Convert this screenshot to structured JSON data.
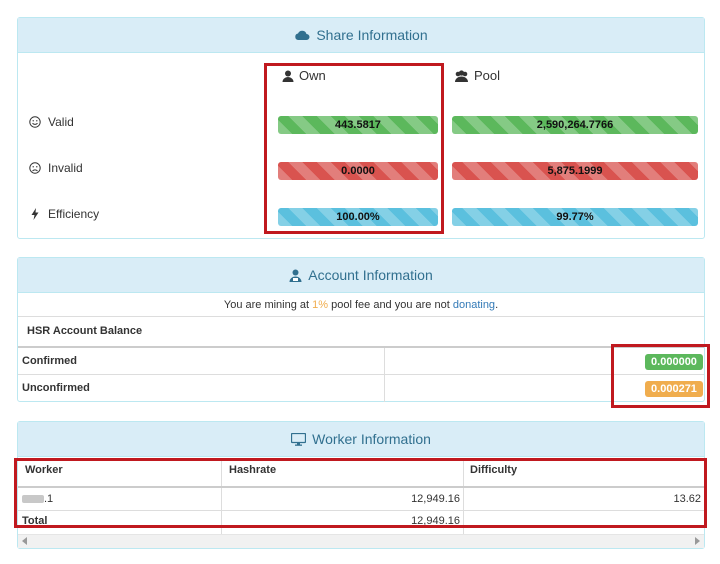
{
  "share_panel": {
    "title": "Share Information",
    "col_own": "Own",
    "col_pool": "Pool",
    "rows": [
      {
        "label": "Valid",
        "own": "443.5817",
        "pool": "2,590,264.7766"
      },
      {
        "label": "Invalid",
        "own": "0.0000",
        "pool": "5,875.1999"
      },
      {
        "label": "Efficiency",
        "own": "100.00%",
        "pool": "99.77%"
      }
    ]
  },
  "account_panel": {
    "title": "Account Information",
    "notice_prefix": "You are mining at ",
    "fee": "1%",
    "notice_mid": " pool fee and you are not ",
    "donating_link": "donating",
    "notice_suffix": ".",
    "balance_heading": "HSR Account Balance",
    "confirmed_label": "Confirmed",
    "confirmed_value": "0.000000",
    "unconfirmed_label": "Unconfirmed",
    "unconfirmed_value": "0.000271"
  },
  "worker_panel": {
    "title": "Worker Information",
    "headers": [
      "Worker",
      "Hashrate",
      "Difficulty"
    ],
    "rows": [
      {
        "worker": ".1",
        "hashrate": "12,949.16",
        "difficulty": "13.62"
      }
    ],
    "total_label": "Total",
    "total_hashrate": "12,949.16"
  },
  "colors": {
    "success": "#5cb85c",
    "danger": "#d9534f",
    "info": "#5bc0de",
    "warning": "#f0ad4e",
    "panel_heading_bg": "#d9edf7",
    "panel_heading_text": "#31708f",
    "highlight_box": "#c0191f"
  }
}
